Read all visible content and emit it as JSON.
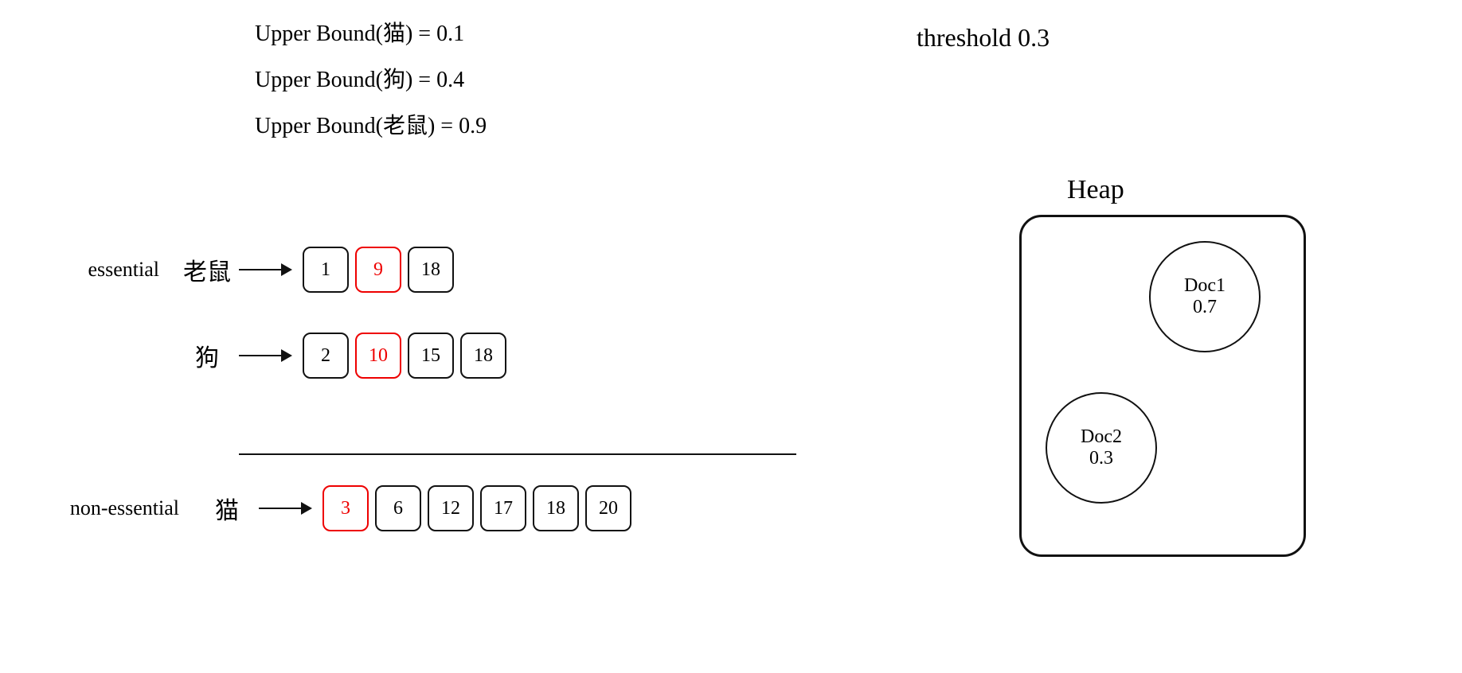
{
  "upper_bounds": {
    "line1": "Upper Bound(猫) = 0.1",
    "line2": "Upper Bound(狗) = 0.4",
    "line3": "Upper Bound(老鼠) = 0.9"
  },
  "threshold": {
    "label": "threshold 0.3"
  },
  "essential_label": "essential",
  "non_essential_label": "non-essential",
  "rows": {
    "laoshu": {
      "term": "老鼠",
      "boxes": [
        {
          "value": "1",
          "red": false
        },
        {
          "value": "9",
          "red": true
        },
        {
          "value": "18",
          "red": false
        }
      ]
    },
    "gou": {
      "term": "狗",
      "boxes": [
        {
          "value": "2",
          "red": false
        },
        {
          "value": "10",
          "red": true
        },
        {
          "value": "15",
          "red": false
        },
        {
          "value": "18",
          "red": false
        }
      ]
    },
    "mao": {
      "term": "猫",
      "boxes": [
        {
          "value": "3",
          "red": true
        },
        {
          "value": "6",
          "red": false
        },
        {
          "value": "12",
          "red": false
        },
        {
          "value": "17",
          "red": false
        },
        {
          "value": "18",
          "red": false
        },
        {
          "value": "20",
          "red": false
        }
      ]
    }
  },
  "heap": {
    "title": "Heap",
    "doc1": {
      "name": "Doc1",
      "score": "0.7"
    },
    "doc2": {
      "name": "Doc2",
      "score": "0.3"
    }
  }
}
